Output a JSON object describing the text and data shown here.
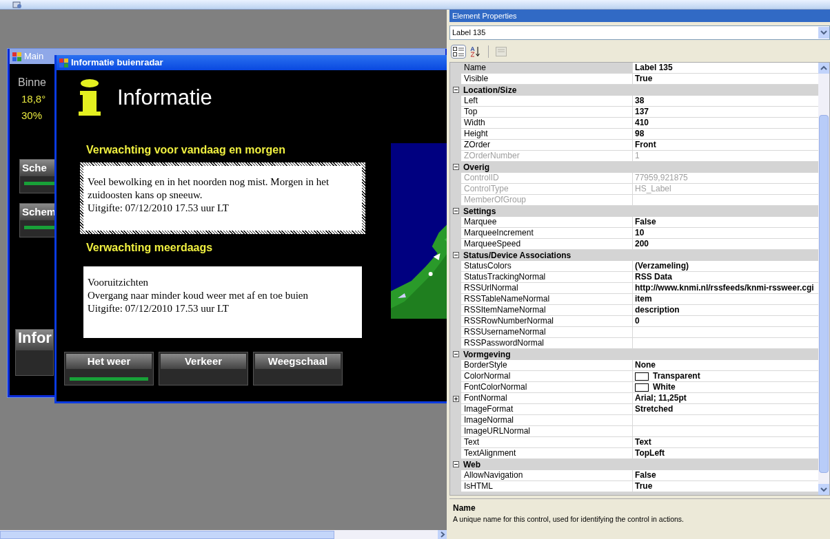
{
  "main_window": {
    "title": "Main",
    "labels": [
      {
        "kind": "plain",
        "text": "Binne"
      },
      {
        "kind": "value",
        "text": "18,8°"
      },
      {
        "kind": "value",
        "text": "30%"
      }
    ],
    "buttons": [
      {
        "kind": "small",
        "label": "Sche",
        "selected": true
      },
      {
        "kind": "small",
        "label": "Schem",
        "selected": true
      },
      {
        "kind": "large",
        "label": "Infor",
        "selected": false
      }
    ]
  },
  "info_window": {
    "title": "Informatie buienradar",
    "heading": "Informatie",
    "sections": [
      {
        "title": "Verwachting voor vandaag en morgen",
        "focused": true,
        "lines": [
          "Veel bewolking en in het noorden nog mist. Morgen in het zuidoosten kans op sneeuw.",
          "Uitgifte: 07/12/2010 17.53 uur LT"
        ]
      },
      {
        "title": "Verwachting meerdaags",
        "focused": false,
        "lines": [
          "Vooruitzichten",
          "Overgang naar minder koud weer met af en toe buien",
          "Uitgifte: 07/12/2010 17.53 uur LT"
        ]
      }
    ],
    "buttons": [
      {
        "label": "Het weer",
        "selected": true
      },
      {
        "label": "Verkeer",
        "selected": false
      },
      {
        "label": "Weegschaal",
        "selected": false
      }
    ]
  },
  "properties_panel": {
    "title": "Element Properties",
    "element": "Label 135",
    "toolbar": [
      {
        "kind": "categorized",
        "selected": true,
        "disabled": false
      },
      {
        "kind": "alphabetical",
        "selected": false,
        "disabled": false
      },
      {
        "kind": "pages",
        "selected": false,
        "disabled": true
      }
    ],
    "rows": [
      {
        "kind": "property",
        "name": "Name",
        "value": "Label 135",
        "selected": true,
        "disabled": false
      },
      {
        "kind": "property",
        "name": "Visible",
        "value": "True",
        "selected": false,
        "disabled": false
      },
      {
        "kind": "category",
        "name": "Location/Size",
        "expanded": true
      },
      {
        "kind": "property",
        "name": "Left",
        "value": "38",
        "selected": false,
        "disabled": false
      },
      {
        "kind": "property",
        "name": "Top",
        "value": "137",
        "selected": false,
        "disabled": false
      },
      {
        "kind": "property",
        "name": "Width",
        "value": "410",
        "selected": false,
        "disabled": false
      },
      {
        "kind": "property",
        "name": "Height",
        "value": "98",
        "selected": false,
        "disabled": false
      },
      {
        "kind": "property",
        "name": "ZOrder",
        "value": "Front",
        "selected": false,
        "disabled": false
      },
      {
        "kind": "property",
        "name": "ZOrderNumber",
        "value": "1",
        "selected": false,
        "disabled": true
      },
      {
        "kind": "category",
        "name": "Overig",
        "expanded": true
      },
      {
        "kind": "property",
        "name": "ControlID",
        "value": "77959,921875",
        "selected": false,
        "disabled": true
      },
      {
        "kind": "property",
        "name": "ControlType",
        "value": "HS_Label",
        "selected": false,
        "disabled": true
      },
      {
        "kind": "property",
        "name": "MemberOfGroup",
        "selected": false,
        "disabled": true
      },
      {
        "kind": "category",
        "name": "Settings",
        "expanded": true
      },
      {
        "kind": "property",
        "name": "Marquee",
        "value": "False",
        "selected": false,
        "disabled": false
      },
      {
        "kind": "property",
        "name": "MarqueeIncrement",
        "value": "10",
        "selected": false,
        "disabled": false
      },
      {
        "kind": "property",
        "name": "MarqueeSpeed",
        "value": "200",
        "selected": false,
        "disabled": false
      },
      {
        "kind": "category",
        "name": "Status/Device Associations",
        "expanded": true
      },
      {
        "kind": "property",
        "name": "StatusColors",
        "value": "(Verzameling)",
        "selected": false,
        "disabled": false
      },
      {
        "kind": "property",
        "name": "StatusTrackingNormal",
        "value": "RSS Data",
        "selected": false,
        "disabled": false
      },
      {
        "kind": "property",
        "name": "RSSUrlNormal",
        "value": "http://www.knmi.nl/rssfeeds/knmi-rssweer.cgi",
        "selected": false,
        "disabled": false
      },
      {
        "kind": "property",
        "name": "RSSTableNameNormal",
        "value": "item",
        "selected": false,
        "disabled": false
      },
      {
        "kind": "property",
        "name": "RSSItemNameNormal",
        "value": "description",
        "selected": false,
        "disabled": false
      },
      {
        "kind": "property",
        "name": "RSSRowNumberNormal",
        "value": "0",
        "selected": false,
        "disabled": false
      },
      {
        "kind": "property",
        "name": "RSSUsernameNormal",
        "selected": false,
        "disabled": false
      },
      {
        "kind": "property",
        "name": "RSSPasswordNormal",
        "selected": false,
        "disabled": false
      },
      {
        "kind": "category",
        "name": "Vormgeving",
        "expanded": true
      },
      {
        "kind": "property",
        "name": "BorderStyle",
        "value": "None",
        "selected": false,
        "disabled": false
      },
      {
        "kind": "color_property",
        "name": "ColorNormal",
        "value": "Transparent",
        "selected": false,
        "disabled": false
      },
      {
        "kind": "color_property",
        "name": "FontColorNormal",
        "value": "White",
        "selected": false,
        "disabled": false
      },
      {
        "kind": "property",
        "name": "FontNormal",
        "value": "Arial; 11,25pt",
        "selected": false,
        "disabled": false,
        "expanded": false
      },
      {
        "kind": "property",
        "name": "ImageFormat",
        "value": "Stretched",
        "selected": false,
        "disabled": false
      },
      {
        "kind": "property",
        "name": "ImageNormal",
        "selected": false,
        "disabled": false
      },
      {
        "kind": "property",
        "name": "ImageURLNormal",
        "selected": false,
        "disabled": false
      },
      {
        "kind": "property",
        "name": "Text",
        "value": "Text",
        "selected": false,
        "disabled": false
      },
      {
        "kind": "property",
        "name": "TextAlignment",
        "value": "TopLeft",
        "selected": false,
        "disabled": false
      },
      {
        "kind": "category",
        "name": "Web",
        "expanded": true
      },
      {
        "kind": "property",
        "name": "AllowNavigation",
        "value": "False",
        "selected": false,
        "disabled": false
      },
      {
        "kind": "property",
        "name": "IsHTML",
        "value": "True",
        "selected": false,
        "disabled": false
      }
    ],
    "description": {
      "title": "Name",
      "text": "A unique name for this control, used for identifying the control in actions."
    }
  }
}
